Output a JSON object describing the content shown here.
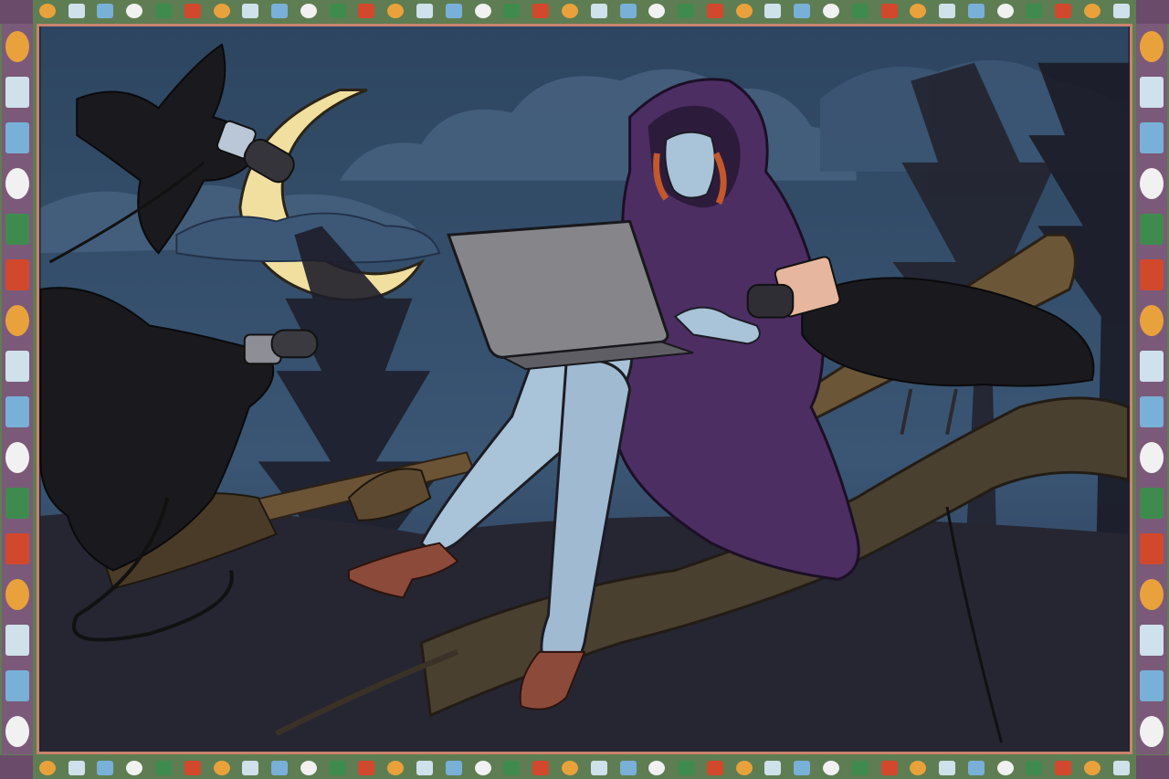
{
  "scene": {
    "subject": "hooded-witch-with-laptop",
    "palette": {
      "sky": "#2f4660",
      "sky_light": "#3f5a78",
      "cloud": "#425e7c",
      "ground": "#22222f",
      "moon": "#f1dfa0",
      "cloak": "#4d2e63",
      "cloak_light": "#6a4886",
      "skin": "#a9c3d9",
      "hair": "#c2582c",
      "laptop": "#85858a",
      "branch": "#5a4a34",
      "branch_dark": "#3a2f22",
      "crow": "#1a1a1e",
      "shoe": "#8c4a3a",
      "frame_green": "#5f7d52",
      "frame_purple": "#7a5a78",
      "frame_edge": "#c9836e"
    },
    "icons": [
      "crescent-moon",
      "crow",
      "microphone",
      "laptop",
      "broom",
      "branch",
      "pine-tree"
    ]
  }
}
